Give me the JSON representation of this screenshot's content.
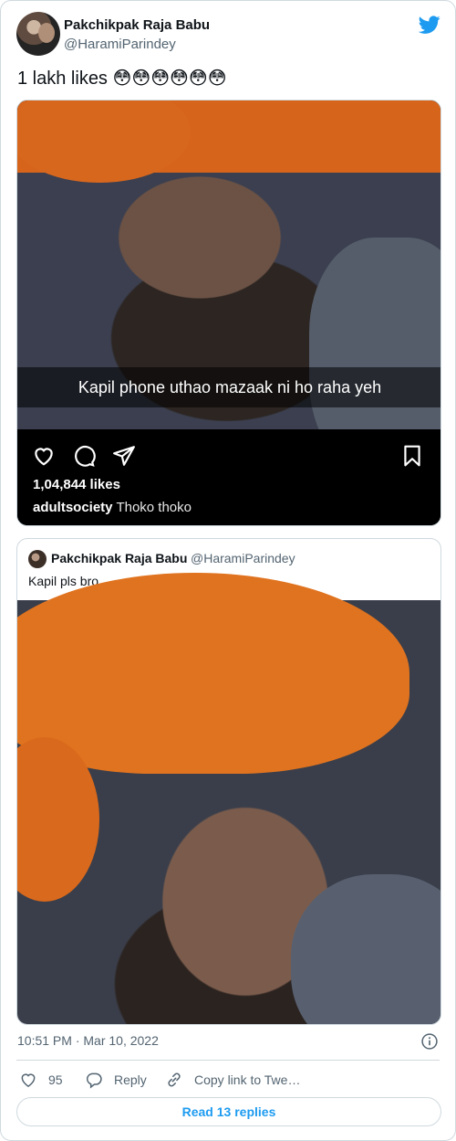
{
  "author": {
    "name": "Pakchikpak Raja Babu",
    "handle": "@HaramiParindey"
  },
  "tweet": {
    "text": "1 lakh likes 😳😳😳😳😳😳"
  },
  "instagram_post": {
    "photo_caption": "Kapil phone uthao mazaak ni ho raha yeh",
    "likes": "1,04,844 likes",
    "username": "adultsociety",
    "caption": "Thoko thoko"
  },
  "quoted_tweet": {
    "name": "Pakchikpak Raja Babu",
    "handle": "@HaramiParindey",
    "text": "Kapil pls bro"
  },
  "meta": {
    "timestamp": "10:51 PM · Mar 10, 2022"
  },
  "actions": {
    "like_count": "95",
    "reply_label": "Reply",
    "copy_label": "Copy link to Twe…"
  },
  "read_replies_label": "Read 13 replies",
  "colors": {
    "accent": "#1d9bf0",
    "secondary_text": "#536471",
    "border": "#cfd9de"
  }
}
